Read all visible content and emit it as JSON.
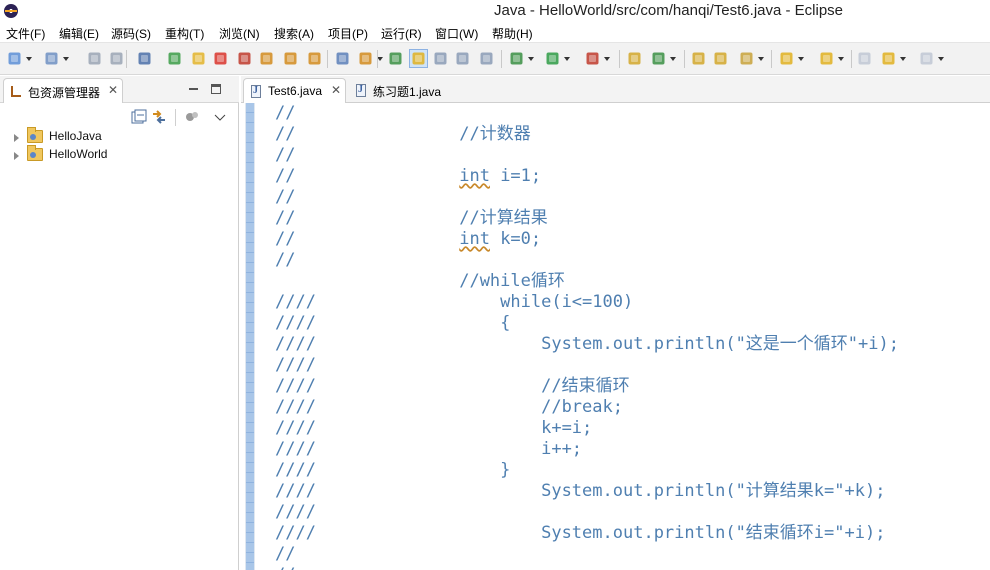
{
  "window": {
    "title": "Java - HelloWorld/src/com/hanqi/Test6.java - Eclipse"
  },
  "menu": [
    {
      "label": "文件(F)"
    },
    {
      "label": "编辑(E)"
    },
    {
      "label": "源码(S)"
    },
    {
      "label": "重构(T)"
    },
    {
      "label": "浏览(N)"
    },
    {
      "label": "搜索(A)"
    },
    {
      "label": "项目(P)"
    },
    {
      "label": "运行(R)"
    },
    {
      "label": "窗口(W)"
    },
    {
      "label": "帮助(H)"
    }
  ],
  "toolbar": {
    "buttons": [
      {
        "name": "new-wizard-icon",
        "color": "#5a8ed6"
      },
      {
        "name": "new-java-project-icon",
        "color": "#6d8fc2"
      },
      {
        "name": "save-icon",
        "color": "#9aa5b4"
      },
      {
        "name": "save-all-icon",
        "color": "#9aa5b4"
      },
      {
        "name": "skip-breakpoints-icon",
        "color": "#4a6fa8"
      },
      {
        "name": "resume-icon",
        "color": "#3b9c46"
      },
      {
        "name": "suspend-icon",
        "color": "#e3b42a"
      },
      {
        "name": "terminate-icon",
        "color": "#d9342b"
      },
      {
        "name": "disconnect-icon",
        "color": "#c0392b"
      },
      {
        "name": "step-into-icon",
        "color": "#d28b1d"
      },
      {
        "name": "step-over-icon",
        "color": "#d28b1d"
      },
      {
        "name": "step-return-icon",
        "color": "#d28b1d"
      },
      {
        "name": "toggle-block-selection-icon",
        "color": "#5a7fb8"
      },
      {
        "name": "use-step-filters-icon",
        "color": "#d28b1d"
      },
      {
        "name": "toggle-breakpoint-icon",
        "color": "#3a8f43"
      },
      {
        "name": "mark-occurrences-icon",
        "color": "#e0b020"
      },
      {
        "name": "word-wrap-icon",
        "color": "#8a9bb5"
      },
      {
        "name": "block-selection-icon",
        "color": "#8a9bb5"
      },
      {
        "name": "show-whitespace-icon",
        "color": "#8a9bb5"
      },
      {
        "name": "debug-icon",
        "color": "#3a8f43"
      },
      {
        "name": "run-icon",
        "color": "#2d9b44"
      },
      {
        "name": "external-tools-icon",
        "color": "#c0392b"
      },
      {
        "name": "new-java-package-icon",
        "color": "#d2a72a"
      },
      {
        "name": "new-java-class-icon",
        "color": "#3a8f43"
      },
      {
        "name": "open-type-icon",
        "color": "#d2a72a"
      },
      {
        "name": "open-task-icon",
        "color": "#d2a72a"
      },
      {
        "name": "search-icon",
        "color": "#c8a23a"
      },
      {
        "name": "next-annotation-icon",
        "color": "#e0b020"
      },
      {
        "name": "previous-annotation-icon",
        "color": "#e0b020"
      },
      {
        "name": "last-edit-location-icon",
        "color": "#bfc7d3"
      },
      {
        "name": "back-icon",
        "color": "#e0b020"
      },
      {
        "name": "forward-icon",
        "color": "#bfc7d3"
      }
    ]
  },
  "package_explorer": {
    "title": "包资源管理器",
    "close": "✕",
    "items": [
      {
        "label": "HelloJava"
      },
      {
        "label": "HelloWorld"
      }
    ]
  },
  "editor": {
    "tabs": [
      {
        "label": "Test6.java",
        "close": "✕",
        "active": true
      },
      {
        "label": "练习题1.java",
        "active": false
      }
    ],
    "lines": [
      {
        "parts": [
          {
            "text": "//"
          }
        ]
      },
      {
        "parts": [
          {
            "text": "//                //计数器"
          }
        ]
      },
      {
        "parts": [
          {
            "text": "//"
          }
        ]
      },
      {
        "parts": [
          {
            "text": "//                "
          },
          {
            "text": "int",
            "warn": true
          },
          {
            "text": " i=1;"
          }
        ]
      },
      {
        "parts": [
          {
            "text": "//"
          }
        ]
      },
      {
        "parts": [
          {
            "text": "//                //计算结果"
          }
        ]
      },
      {
        "parts": [
          {
            "text": "//                "
          },
          {
            "text": "int",
            "warn": true
          },
          {
            "text": " k=0;"
          }
        ]
      },
      {
        "parts": [
          {
            "text": "//"
          }
        ]
      },
      {
        "parts": [
          {
            "text": "                  //while循环"
          }
        ]
      },
      {
        "parts": [
          {
            "text": "////                  while(i<=100)"
          }
        ]
      },
      {
        "parts": [
          {
            "text": "////                  {"
          }
        ]
      },
      {
        "parts": [
          {
            "text": "////                      System.out.println(\"这是一个循环\"+i);"
          }
        ]
      },
      {
        "parts": [
          {
            "text": "////"
          }
        ]
      },
      {
        "parts": [
          {
            "text": "////                      //结束循环"
          }
        ]
      },
      {
        "parts": [
          {
            "text": "////                      //break;"
          }
        ]
      },
      {
        "parts": [
          {
            "text": "////                      k+=i;"
          }
        ]
      },
      {
        "parts": [
          {
            "text": "////                      i++;"
          }
        ]
      },
      {
        "parts": [
          {
            "text": "////                  }"
          }
        ]
      },
      {
        "parts": [
          {
            "text": "////                      System.out.println(\"计算结果k=\"+k);"
          }
        ]
      },
      {
        "parts": [
          {
            "text": "////"
          }
        ]
      },
      {
        "parts": [
          {
            "text": "////                      System.out.println(\"结束循环i=\"+i);"
          }
        ]
      },
      {
        "parts": [
          {
            "text": "//"
          }
        ]
      },
      {
        "parts": [
          {
            "text": "//"
          }
        ]
      }
    ]
  }
}
